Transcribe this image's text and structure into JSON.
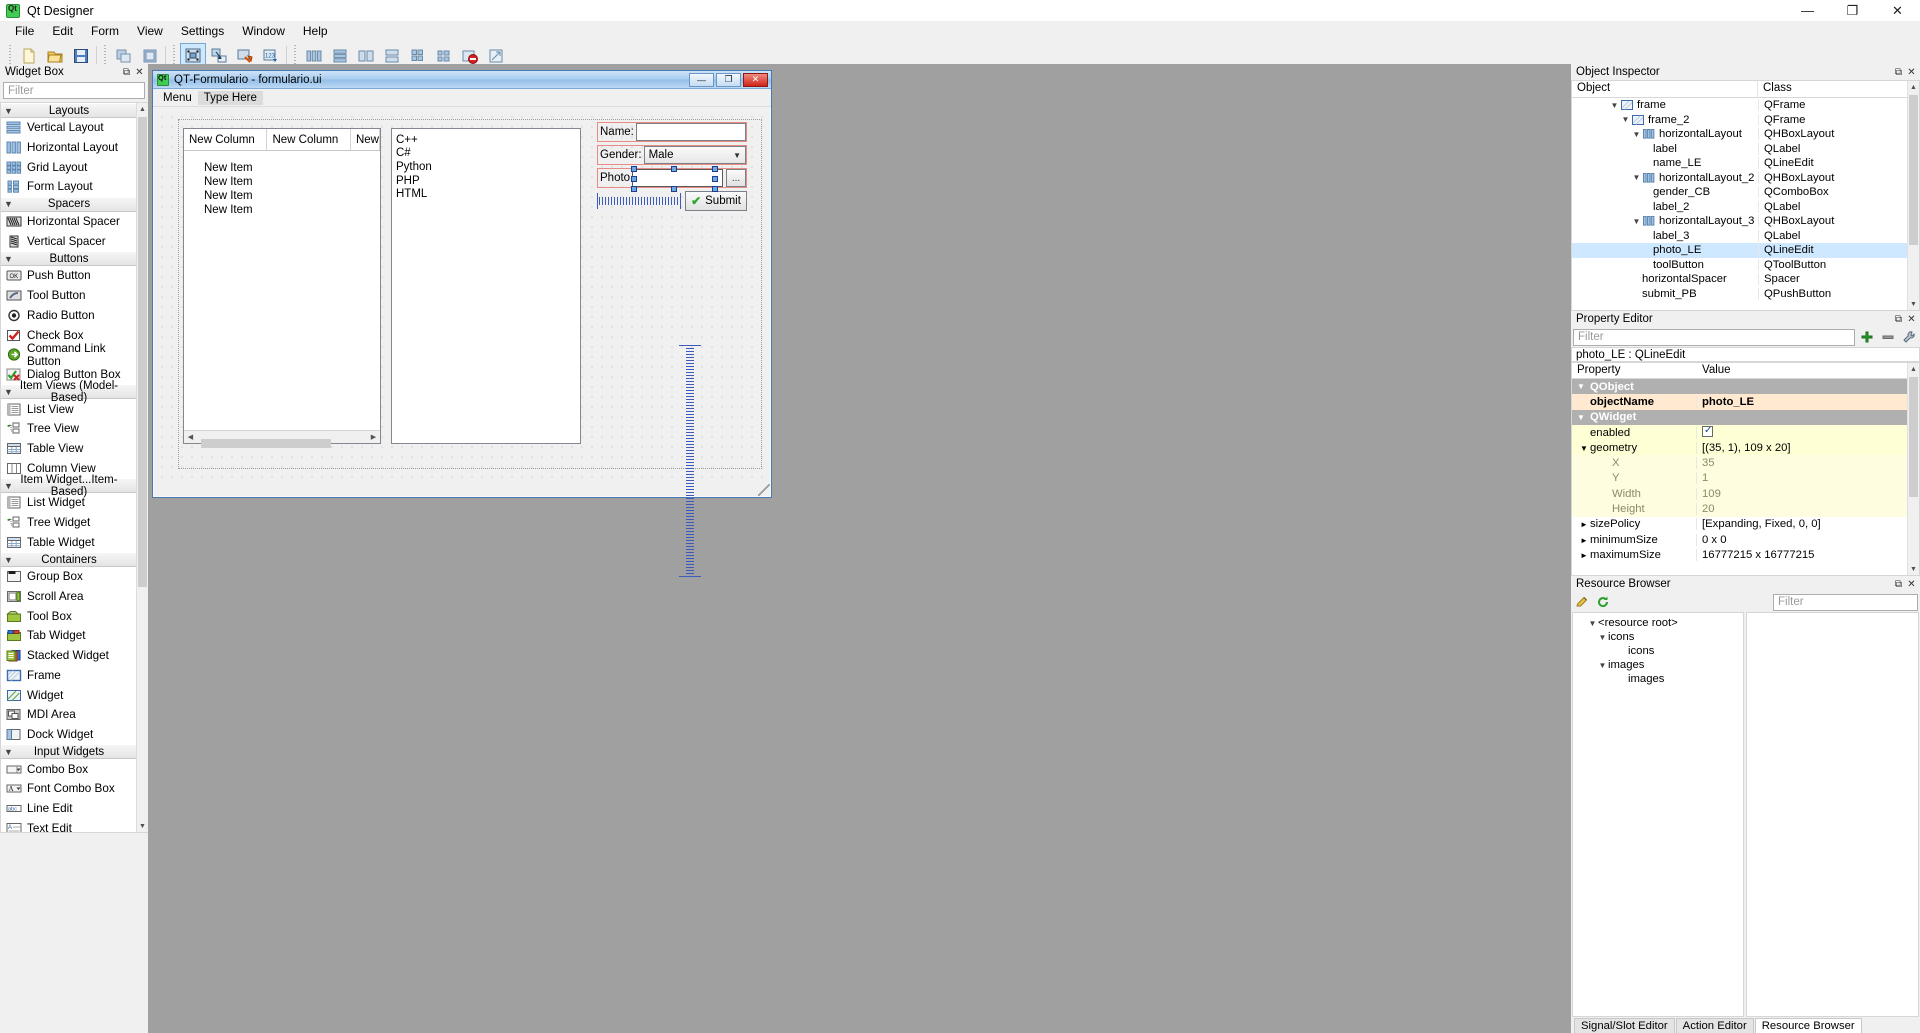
{
  "app": {
    "title": "Qt Designer",
    "logo_icon": "qt-logo-icon",
    "window_buttons": {
      "minimize": "—",
      "maximize": "❐",
      "close": "✕"
    }
  },
  "menubar": {
    "items": [
      "File",
      "Edit",
      "Form",
      "View",
      "Settings",
      "Window",
      "Help"
    ]
  },
  "toolbar": {
    "groups": [
      [
        "new-file-icon",
        "open-file-icon",
        "save-file-icon"
      ],
      [
        "undo-icon",
        "redo-icon"
      ],
      [
        "edit-widgets-icon",
        "edit-signals-slots-icon",
        "edit-buddies-icon",
        "edit-tab-order-icon"
      ],
      [
        "layout-horizontally-icon",
        "layout-vertically-icon",
        "layout-splitter-h-icon",
        "layout-splitter-v-icon",
        "layout-grid-icon",
        "layout-form-icon",
        "break-layout-icon",
        "adjust-size-icon"
      ]
    ]
  },
  "widget_box": {
    "title": "Widget Box",
    "float_icon": "float-icon",
    "close_icon": "close-icon",
    "filter_placeholder": "Filter",
    "sections": [
      {
        "label": "Layouts",
        "items": [
          {
            "label": "Vertical Layout",
            "icon": "vertical-layout-icon"
          },
          {
            "label": "Horizontal Layout",
            "icon": "horizontal-layout-icon"
          },
          {
            "label": "Grid Layout",
            "icon": "grid-layout-icon"
          },
          {
            "label": "Form Layout",
            "icon": "form-layout-icon"
          }
        ]
      },
      {
        "label": "Spacers",
        "items": [
          {
            "label": "Horizontal Spacer",
            "icon": "horizontal-spacer-icon"
          },
          {
            "label": "Vertical Spacer",
            "icon": "vertical-spacer-icon"
          }
        ]
      },
      {
        "label": "Buttons",
        "items": [
          {
            "label": "Push Button",
            "icon": "push-button-icon"
          },
          {
            "label": "Tool Button",
            "icon": "tool-button-icon"
          },
          {
            "label": "Radio Button",
            "icon": "radio-button-icon"
          },
          {
            "label": "Check Box",
            "icon": "check-box-icon"
          },
          {
            "label": "Command Link Button",
            "icon": "command-link-button-icon"
          },
          {
            "label": "Dialog Button Box",
            "icon": "dialog-button-box-icon"
          }
        ]
      },
      {
        "label": "Item Views (Model-Based)",
        "items": [
          {
            "label": "List View",
            "icon": "list-view-icon"
          },
          {
            "label": "Tree View",
            "icon": "tree-view-icon"
          },
          {
            "label": "Table View",
            "icon": "table-view-icon"
          },
          {
            "label": "Column View",
            "icon": "column-view-icon"
          }
        ]
      },
      {
        "label": "Item Widget...Item-Based)",
        "items": [
          {
            "label": "List Widget",
            "icon": "list-widget-icon"
          },
          {
            "label": "Tree Widget",
            "icon": "tree-widget-icon"
          },
          {
            "label": "Table Widget",
            "icon": "table-widget-icon"
          }
        ]
      },
      {
        "label": "Containers",
        "items": [
          {
            "label": "Group Box",
            "icon": "group-box-icon"
          },
          {
            "label": "Scroll Area",
            "icon": "scroll-area-icon"
          },
          {
            "label": "Tool Box",
            "icon": "tool-box-icon"
          },
          {
            "label": "Tab Widget",
            "icon": "tab-widget-icon"
          },
          {
            "label": "Stacked Widget",
            "icon": "stacked-widget-icon"
          },
          {
            "label": "Frame",
            "icon": "frame-icon"
          },
          {
            "label": "Widget",
            "icon": "widget-icon"
          },
          {
            "label": "MDI Area",
            "icon": "mdi-area-icon"
          },
          {
            "label": "Dock Widget",
            "icon": "dock-widget-icon"
          }
        ]
      },
      {
        "label": "Input Widgets",
        "items": [
          {
            "label": "Combo Box",
            "icon": "combo-box-icon"
          },
          {
            "label": "Font Combo Box",
            "icon": "font-combo-box-icon"
          },
          {
            "label": "Line Edit",
            "icon": "line-edit-icon"
          },
          {
            "label": "Text Edit",
            "icon": "text-edit-icon"
          }
        ]
      }
    ]
  },
  "form_window": {
    "title": "QT-Formulario - formulario.ui",
    "logo_icon": "qt-logo-icon",
    "buttons": {
      "minimize": "—",
      "maximize": "❐",
      "close": "✕"
    },
    "menu": {
      "menu_label": "Menu",
      "type_here_label": "Type Here"
    },
    "table": {
      "columns": [
        "New Column",
        "New Column",
        "New"
      ],
      "rows": [
        "New Item",
        "New Item",
        "New Item",
        "New Item"
      ]
    },
    "list": {
      "items": [
        "C++",
        "C#",
        "Python",
        "PHP",
        "HTML"
      ]
    },
    "fields": {
      "name_label": "Name:",
      "name_value": "",
      "gender_label": "Gender:",
      "gender_value": "Male",
      "photo_label": "Photo",
      "photo_value": "",
      "browse_label": "...",
      "submit_label": "Submit",
      "submit_icon": "check-icon"
    }
  },
  "object_inspector": {
    "title": "Object Inspector",
    "float_icon": "float-icon",
    "close_icon": "close-icon",
    "columns": [
      "Object",
      "Class"
    ],
    "rows": [
      {
        "name": "frame",
        "class": "QFrame",
        "indent": 3,
        "chevron": "⌄",
        "icon": "frame-icon",
        "selected": false
      },
      {
        "name": "frame_2",
        "class": "QFrame",
        "indent": 4,
        "chevron": "⌄",
        "icon": "frame-icon",
        "selected": false
      },
      {
        "name": "horizontalLayout",
        "class": "QHBoxLayout",
        "indent": 5,
        "chevron": "⌄",
        "icon": "hbox-layout-icon",
        "selected": false
      },
      {
        "name": "label",
        "class": "QLabel",
        "indent": 7,
        "chevron": "",
        "icon": "",
        "selected": false
      },
      {
        "name": "name_LE",
        "class": "QLineEdit",
        "indent": 7,
        "chevron": "",
        "icon": "",
        "selected": false
      },
      {
        "name": "horizontalLayout_2",
        "class": "QHBoxLayout",
        "indent": 5,
        "chevron": "⌄",
        "icon": "hbox-layout-icon",
        "selected": false
      },
      {
        "name": "gender_CB",
        "class": "QComboBox",
        "indent": 7,
        "chevron": "",
        "icon": "",
        "selected": false
      },
      {
        "name": "label_2",
        "class": "QLabel",
        "indent": 7,
        "chevron": "",
        "icon": "",
        "selected": false
      },
      {
        "name": "horizontalLayout_3",
        "class": "QHBoxLayout",
        "indent": 5,
        "chevron": "⌄",
        "icon": "hbox-layout-icon",
        "selected": false
      },
      {
        "name": "label_3",
        "class": "QLabel",
        "indent": 7,
        "chevron": "",
        "icon": "",
        "selected": false
      },
      {
        "name": "photo_LE",
        "class": "QLineEdit",
        "indent": 7,
        "chevron": "",
        "icon": "",
        "selected": true
      },
      {
        "name": "toolButton",
        "class": "QToolButton",
        "indent": 7,
        "chevron": "",
        "icon": "",
        "selected": false
      },
      {
        "name": "horizontalSpacer",
        "class": "Spacer",
        "indent": 6,
        "chevron": "",
        "icon": "",
        "selected": false
      },
      {
        "name": "submit_PB",
        "class": "QPushButton",
        "indent": 6,
        "chevron": "",
        "icon": "",
        "selected": false
      }
    ]
  },
  "property_editor": {
    "title": "Property Editor",
    "float_icon": "float-icon",
    "close_icon": "close-icon",
    "filter_placeholder": "Filter",
    "add_icon": "plus-icon",
    "remove_icon": "minus-icon",
    "config_icon": "wrench-icon",
    "object_label": "photo_LE : QLineEdit",
    "columns": [
      "Property",
      "Value"
    ],
    "rows": [
      {
        "name": "QObject",
        "value": "",
        "type": "group",
        "chevron": "⌄"
      },
      {
        "name": "objectName",
        "value": "photo_LE",
        "type": "orange"
      },
      {
        "name": "QWidget",
        "value": "",
        "type": "group",
        "chevron": "⌄"
      },
      {
        "name": "enabled",
        "value": "",
        "type": "yellow",
        "checkbox": true
      },
      {
        "name": "geometry",
        "value": "[(35, 1), 109 x 20]",
        "type": "yellow",
        "chevron": "⌄"
      },
      {
        "name": "X",
        "value": "35",
        "type": "sub"
      },
      {
        "name": "Y",
        "value": "1",
        "type": "sub"
      },
      {
        "name": "Width",
        "value": "109",
        "type": "sub"
      },
      {
        "name": "Height",
        "value": "20",
        "type": "sub"
      },
      {
        "name": "sizePolicy",
        "value": "[Expanding, Fixed, 0, 0]",
        "type": "plain",
        "chevron": "›"
      },
      {
        "name": "minimumSize",
        "value": "0 x 0",
        "type": "plain",
        "chevron": "›"
      },
      {
        "name": "maximumSize",
        "value": "16777215 x 16777215",
        "type": "plain",
        "chevron": "›"
      }
    ]
  },
  "resource_browser": {
    "title": "Resource Browser",
    "float_icon": "float-icon",
    "close_icon": "close-icon",
    "edit_icon": "pencil-icon",
    "reload_icon": "reload-icon",
    "filter_placeholder": "Filter",
    "tree": [
      {
        "label": "<resource root>",
        "indent": 1,
        "chevron": "⌄"
      },
      {
        "label": "icons",
        "indent": 2,
        "chevron": "⌄"
      },
      {
        "label": "icons",
        "indent": 4,
        "chevron": ""
      },
      {
        "label": "images",
        "indent": 2,
        "chevron": "⌄"
      },
      {
        "label": "images",
        "indent": 4,
        "chevron": ""
      }
    ]
  },
  "bottom_tabs": {
    "tabs": [
      {
        "label": "Signal/Slot Editor",
        "active": false
      },
      {
        "label": "Action Editor",
        "active": false
      },
      {
        "label": "Resource Browser",
        "active": true
      }
    ]
  },
  "colors": {
    "accent": "#41cd52",
    "selection": "#cde8ff",
    "title_gradient": "#a8cdf0",
    "selection_outline": "#e98b84",
    "handle": "#6fa8dc",
    "spacer": "#3b5bbf"
  }
}
